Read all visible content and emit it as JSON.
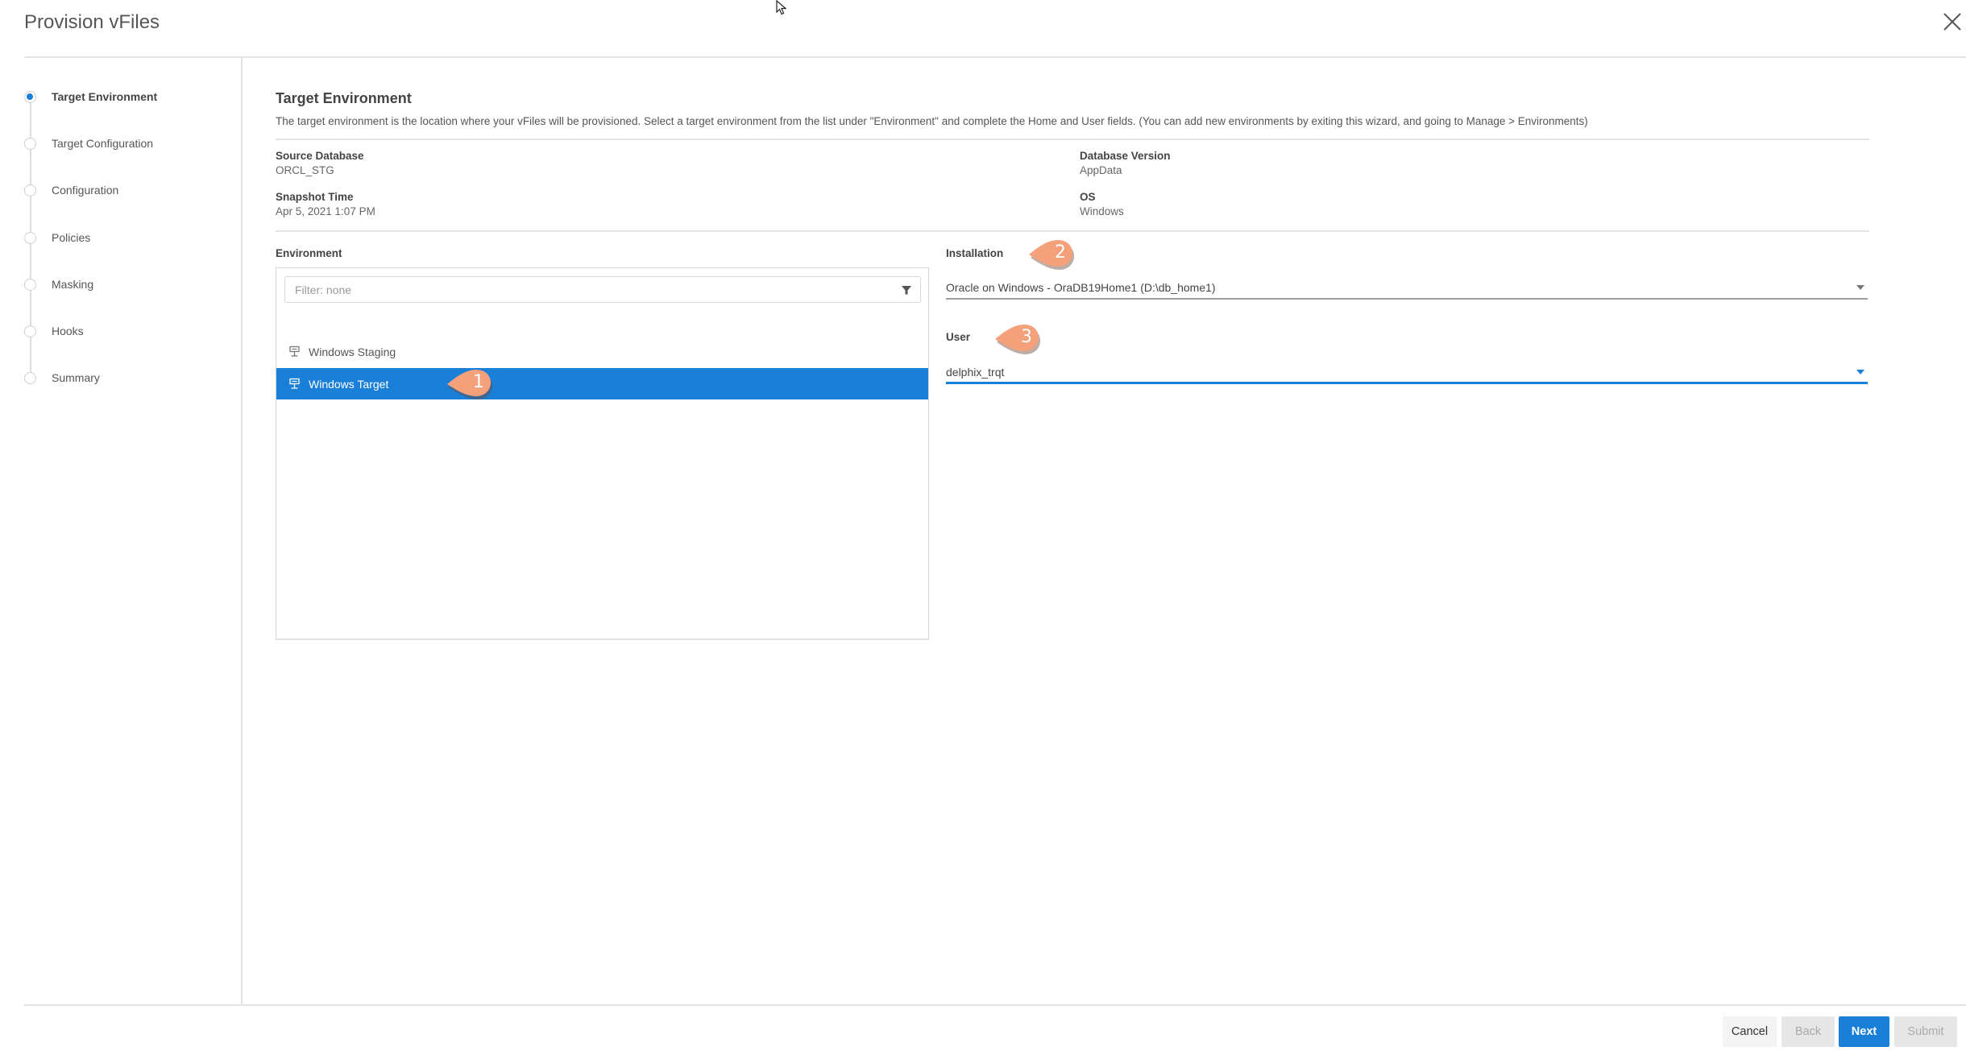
{
  "dialog": {
    "title": "Provision vFiles",
    "close_icon": "close-icon"
  },
  "steps": [
    {
      "label": "Target Environment",
      "active": true
    },
    {
      "label": "Target Configuration",
      "active": false
    },
    {
      "label": "Configuration",
      "active": false
    },
    {
      "label": "Policies",
      "active": false
    },
    {
      "label": "Masking",
      "active": false
    },
    {
      "label": "Hooks",
      "active": false
    },
    {
      "label": "Summary",
      "active": false
    }
  ],
  "main": {
    "heading": "Target Environment",
    "description": "The target environment is the location where your vFiles will be provisioned. Select a target environment from the list under \"Environment\" and complete the Home and User fields. (You can add new environments by exiting this wizard, and going to Manage > Environments)",
    "info": {
      "source_database_label": "Source Database",
      "source_database_value": "ORCL_STG",
      "snapshot_time_label": "Snapshot Time",
      "snapshot_time_value": "Apr 5, 2021 1:07 PM",
      "database_version_label": "Database Version",
      "database_version_value": "AppData",
      "os_label": "OS",
      "os_value": "Windows"
    },
    "environment": {
      "label": "Environment",
      "filter_placeholder": "Filter: none",
      "filter_value": "",
      "items": [
        {
          "label": "Windows Staging",
          "icon": "server-icon",
          "selected": false
        },
        {
          "label": "Windows Target",
          "icon": "server-icon",
          "selected": true
        }
      ]
    },
    "installation": {
      "label": "Installation",
      "value": "Oracle on Windows - OraDB19Home1 (D:\\db_home1)"
    },
    "user": {
      "label": "User",
      "value": "delphix_trqt"
    }
  },
  "callouts": [
    "1",
    "2",
    "3"
  ],
  "footer": {
    "cancel": "Cancel",
    "back": "Back",
    "next": "Next",
    "submit": "Submit"
  },
  "colors": {
    "accent": "#1a7fd6",
    "callout": "#f4a07a"
  }
}
